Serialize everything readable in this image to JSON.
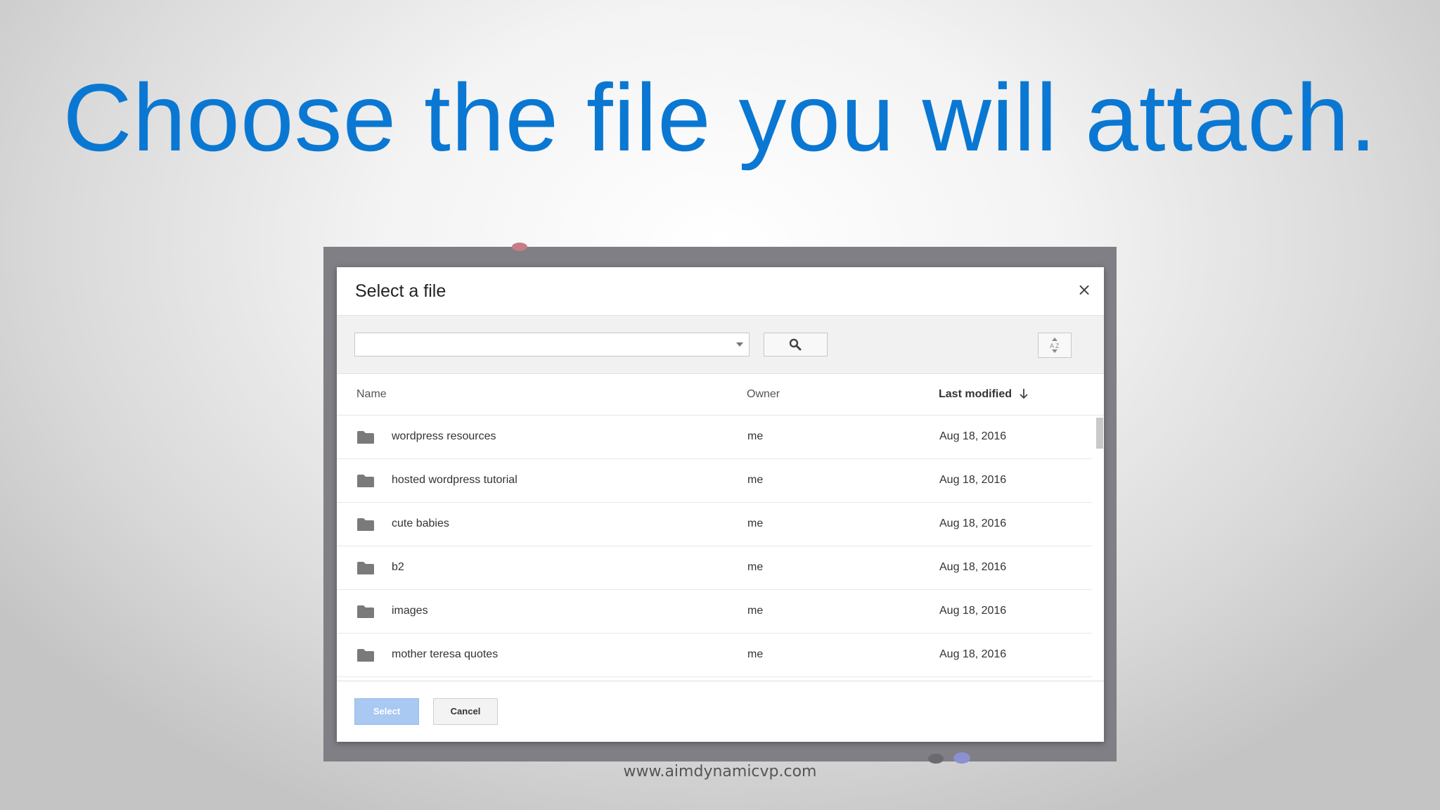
{
  "slide": {
    "title": "Choose the file you will attach.",
    "footer_url": "www.aimdynamicvp.com"
  },
  "dialog": {
    "title": "Select a file",
    "close_label": "×",
    "search": {
      "value": "",
      "placeholder": ""
    },
    "sort_icon_label": "A↕Z"
  },
  "table": {
    "headers": {
      "name": "Name",
      "owner": "Owner",
      "last_modified": "Last modified"
    },
    "sort": {
      "column": "last_modified",
      "direction": "descending",
      "arrow": "↓"
    },
    "rows": [
      {
        "name": "wordpress resources",
        "owner": "me",
        "modified": "Aug 18, 2016"
      },
      {
        "name": "hosted wordpress tutorial",
        "owner": "me",
        "modified": "Aug 18, 2016"
      },
      {
        "name": "cute babies",
        "owner": "me",
        "modified": "Aug 18, 2016"
      },
      {
        "name": "b2",
        "owner": "me",
        "modified": "Aug 18, 2016"
      },
      {
        "name": "images",
        "owner": "me",
        "modified": "Aug 18, 2016"
      },
      {
        "name": "mother teresa quotes",
        "owner": "me",
        "modified": "Aug 18, 2016"
      }
    ]
  },
  "footer": {
    "select_label": "Select",
    "cancel_label": "Cancel"
  },
  "colors": {
    "title_blue": "#0a78d2",
    "select_button_disabled": "#a9c8f2",
    "folder_icon": "#7a7a7a",
    "frame_gray": "#7f7f85"
  },
  "icons": {
    "folder": "folder-icon",
    "search": "search-icon",
    "sort": "sort-az-icon",
    "close": "close-icon",
    "dropdown": "chevron-down-icon"
  }
}
